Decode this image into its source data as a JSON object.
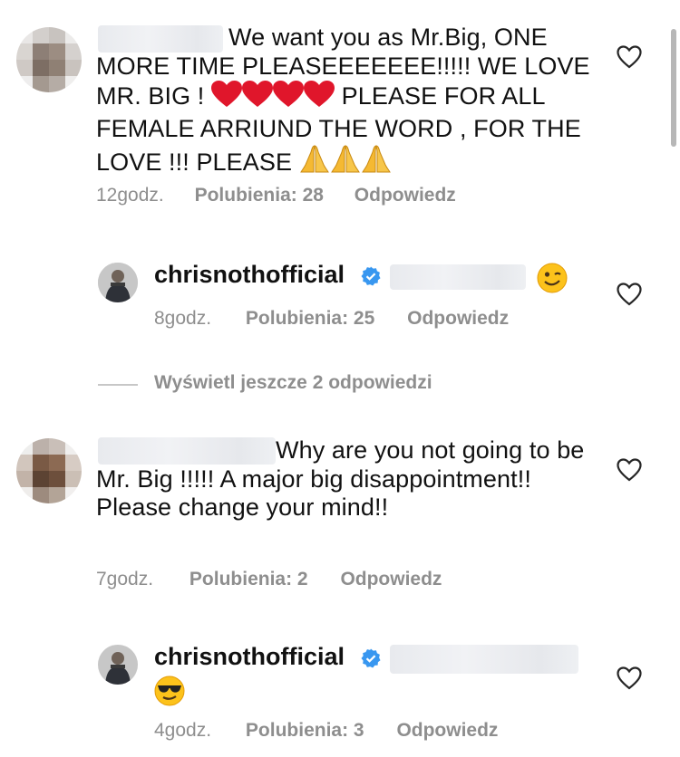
{
  "comments": [
    {
      "text_intro": "We want you as Mr.Big, ONE",
      "text_rest": "MORE TIME PLEASEEEEEEE!!!!! WE LOVE MR. BIG ! ",
      "text_after_hearts": " PLEASE FOR ALL FEMALE ARRIUND THE WORD , FOR THE LOVE !!! PLEASE ",
      "time": "12godz.",
      "likes": "Polubienia: 28",
      "reply": "Odpowiedz"
    },
    {
      "time": "7godz.",
      "likes": "Polubienia: 2",
      "reply": "Odpowiedz",
      "text_intro": "Why are you not going to",
      "text_rest": "be Mr. Big !!!!! A major big disappointment!! Please change your mind!!"
    }
  ],
  "replies": [
    {
      "username": "chrisnothofficial",
      "time": "8godz.",
      "likes": "Polubienia: 25",
      "reply": "Odpowiedz",
      "emoji": "winking-face"
    },
    {
      "username": "chrisnothofficial",
      "time": "4godz.",
      "likes": "Polubienia: 3",
      "reply": "Odpowiedz",
      "emoji": "sunglasses-face"
    }
  ],
  "view_more": "Wyświetl jeszcze 2 odpowiedzi",
  "colors": {
    "meta_gray": "#8e8e8e",
    "verified_blue": "#3897f0",
    "heart_red": "#e0162b"
  }
}
